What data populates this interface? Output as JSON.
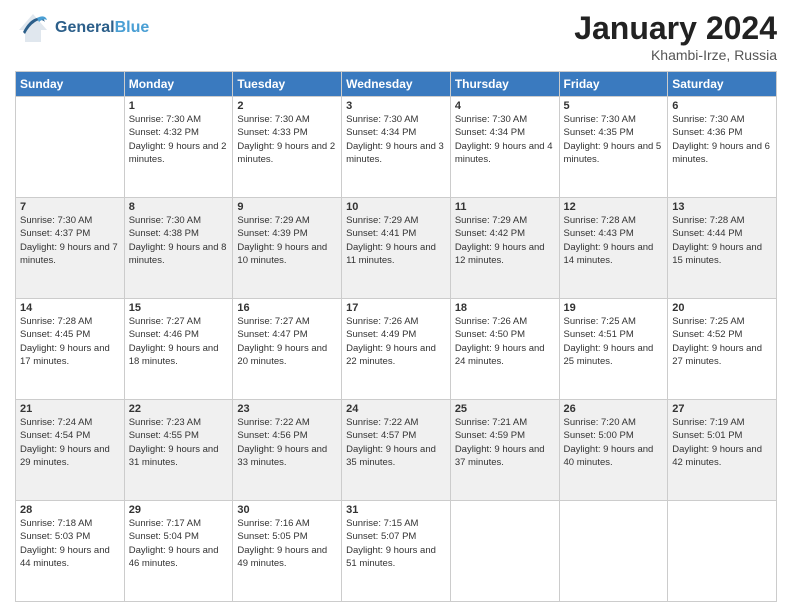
{
  "header": {
    "logo_general": "General",
    "logo_blue": "Blue",
    "month": "January 2024",
    "location": "Khambi-Irze, Russia"
  },
  "days": [
    "Sunday",
    "Monday",
    "Tuesday",
    "Wednesday",
    "Thursday",
    "Friday",
    "Saturday"
  ],
  "weeks": [
    [
      {
        "day": "",
        "sunrise": "",
        "sunset": "",
        "daylight": ""
      },
      {
        "day": "1",
        "sunrise": "Sunrise: 7:30 AM",
        "sunset": "Sunset: 4:32 PM",
        "daylight": "Daylight: 9 hours and 2 minutes."
      },
      {
        "day": "2",
        "sunrise": "Sunrise: 7:30 AM",
        "sunset": "Sunset: 4:33 PM",
        "daylight": "Daylight: 9 hours and 2 minutes."
      },
      {
        "day": "3",
        "sunrise": "Sunrise: 7:30 AM",
        "sunset": "Sunset: 4:34 PM",
        "daylight": "Daylight: 9 hours and 3 minutes."
      },
      {
        "day": "4",
        "sunrise": "Sunrise: 7:30 AM",
        "sunset": "Sunset: 4:34 PM",
        "daylight": "Daylight: 9 hours and 4 minutes."
      },
      {
        "day": "5",
        "sunrise": "Sunrise: 7:30 AM",
        "sunset": "Sunset: 4:35 PM",
        "daylight": "Daylight: 9 hours and 5 minutes."
      },
      {
        "day": "6",
        "sunrise": "Sunrise: 7:30 AM",
        "sunset": "Sunset: 4:36 PM",
        "daylight": "Daylight: 9 hours and 6 minutes."
      }
    ],
    [
      {
        "day": "7",
        "sunrise": "Sunrise: 7:30 AM",
        "sunset": "Sunset: 4:37 PM",
        "daylight": "Daylight: 9 hours and 7 minutes."
      },
      {
        "day": "8",
        "sunrise": "Sunrise: 7:30 AM",
        "sunset": "Sunset: 4:38 PM",
        "daylight": "Daylight: 9 hours and 8 minutes."
      },
      {
        "day": "9",
        "sunrise": "Sunrise: 7:29 AM",
        "sunset": "Sunset: 4:39 PM",
        "daylight": "Daylight: 9 hours and 10 minutes."
      },
      {
        "day": "10",
        "sunrise": "Sunrise: 7:29 AM",
        "sunset": "Sunset: 4:41 PM",
        "daylight": "Daylight: 9 hours and 11 minutes."
      },
      {
        "day": "11",
        "sunrise": "Sunrise: 7:29 AM",
        "sunset": "Sunset: 4:42 PM",
        "daylight": "Daylight: 9 hours and 12 minutes."
      },
      {
        "day": "12",
        "sunrise": "Sunrise: 7:28 AM",
        "sunset": "Sunset: 4:43 PM",
        "daylight": "Daylight: 9 hours and 14 minutes."
      },
      {
        "day": "13",
        "sunrise": "Sunrise: 7:28 AM",
        "sunset": "Sunset: 4:44 PM",
        "daylight": "Daylight: 9 hours and 15 minutes."
      }
    ],
    [
      {
        "day": "14",
        "sunrise": "Sunrise: 7:28 AM",
        "sunset": "Sunset: 4:45 PM",
        "daylight": "Daylight: 9 hours and 17 minutes."
      },
      {
        "day": "15",
        "sunrise": "Sunrise: 7:27 AM",
        "sunset": "Sunset: 4:46 PM",
        "daylight": "Daylight: 9 hours and 18 minutes."
      },
      {
        "day": "16",
        "sunrise": "Sunrise: 7:27 AM",
        "sunset": "Sunset: 4:47 PM",
        "daylight": "Daylight: 9 hours and 20 minutes."
      },
      {
        "day": "17",
        "sunrise": "Sunrise: 7:26 AM",
        "sunset": "Sunset: 4:49 PM",
        "daylight": "Daylight: 9 hours and 22 minutes."
      },
      {
        "day": "18",
        "sunrise": "Sunrise: 7:26 AM",
        "sunset": "Sunset: 4:50 PM",
        "daylight": "Daylight: 9 hours and 24 minutes."
      },
      {
        "day": "19",
        "sunrise": "Sunrise: 7:25 AM",
        "sunset": "Sunset: 4:51 PM",
        "daylight": "Daylight: 9 hours and 25 minutes."
      },
      {
        "day": "20",
        "sunrise": "Sunrise: 7:25 AM",
        "sunset": "Sunset: 4:52 PM",
        "daylight": "Daylight: 9 hours and 27 minutes."
      }
    ],
    [
      {
        "day": "21",
        "sunrise": "Sunrise: 7:24 AM",
        "sunset": "Sunset: 4:54 PM",
        "daylight": "Daylight: 9 hours and 29 minutes."
      },
      {
        "day": "22",
        "sunrise": "Sunrise: 7:23 AM",
        "sunset": "Sunset: 4:55 PM",
        "daylight": "Daylight: 9 hours and 31 minutes."
      },
      {
        "day": "23",
        "sunrise": "Sunrise: 7:22 AM",
        "sunset": "Sunset: 4:56 PM",
        "daylight": "Daylight: 9 hours and 33 minutes."
      },
      {
        "day": "24",
        "sunrise": "Sunrise: 7:22 AM",
        "sunset": "Sunset: 4:57 PM",
        "daylight": "Daylight: 9 hours and 35 minutes."
      },
      {
        "day": "25",
        "sunrise": "Sunrise: 7:21 AM",
        "sunset": "Sunset: 4:59 PM",
        "daylight": "Daylight: 9 hours and 37 minutes."
      },
      {
        "day": "26",
        "sunrise": "Sunrise: 7:20 AM",
        "sunset": "Sunset: 5:00 PM",
        "daylight": "Daylight: 9 hours and 40 minutes."
      },
      {
        "day": "27",
        "sunrise": "Sunrise: 7:19 AM",
        "sunset": "Sunset: 5:01 PM",
        "daylight": "Daylight: 9 hours and 42 minutes."
      }
    ],
    [
      {
        "day": "28",
        "sunrise": "Sunrise: 7:18 AM",
        "sunset": "Sunset: 5:03 PM",
        "daylight": "Daylight: 9 hours and 44 minutes."
      },
      {
        "day": "29",
        "sunrise": "Sunrise: 7:17 AM",
        "sunset": "Sunset: 5:04 PM",
        "daylight": "Daylight: 9 hours and 46 minutes."
      },
      {
        "day": "30",
        "sunrise": "Sunrise: 7:16 AM",
        "sunset": "Sunset: 5:05 PM",
        "daylight": "Daylight: 9 hours and 49 minutes."
      },
      {
        "day": "31",
        "sunrise": "Sunrise: 7:15 AM",
        "sunset": "Sunset: 5:07 PM",
        "daylight": "Daylight: 9 hours and 51 minutes."
      },
      {
        "day": "",
        "sunrise": "",
        "sunset": "",
        "daylight": ""
      },
      {
        "day": "",
        "sunrise": "",
        "sunset": "",
        "daylight": ""
      },
      {
        "day": "",
        "sunrise": "",
        "sunset": "",
        "daylight": ""
      }
    ]
  ]
}
